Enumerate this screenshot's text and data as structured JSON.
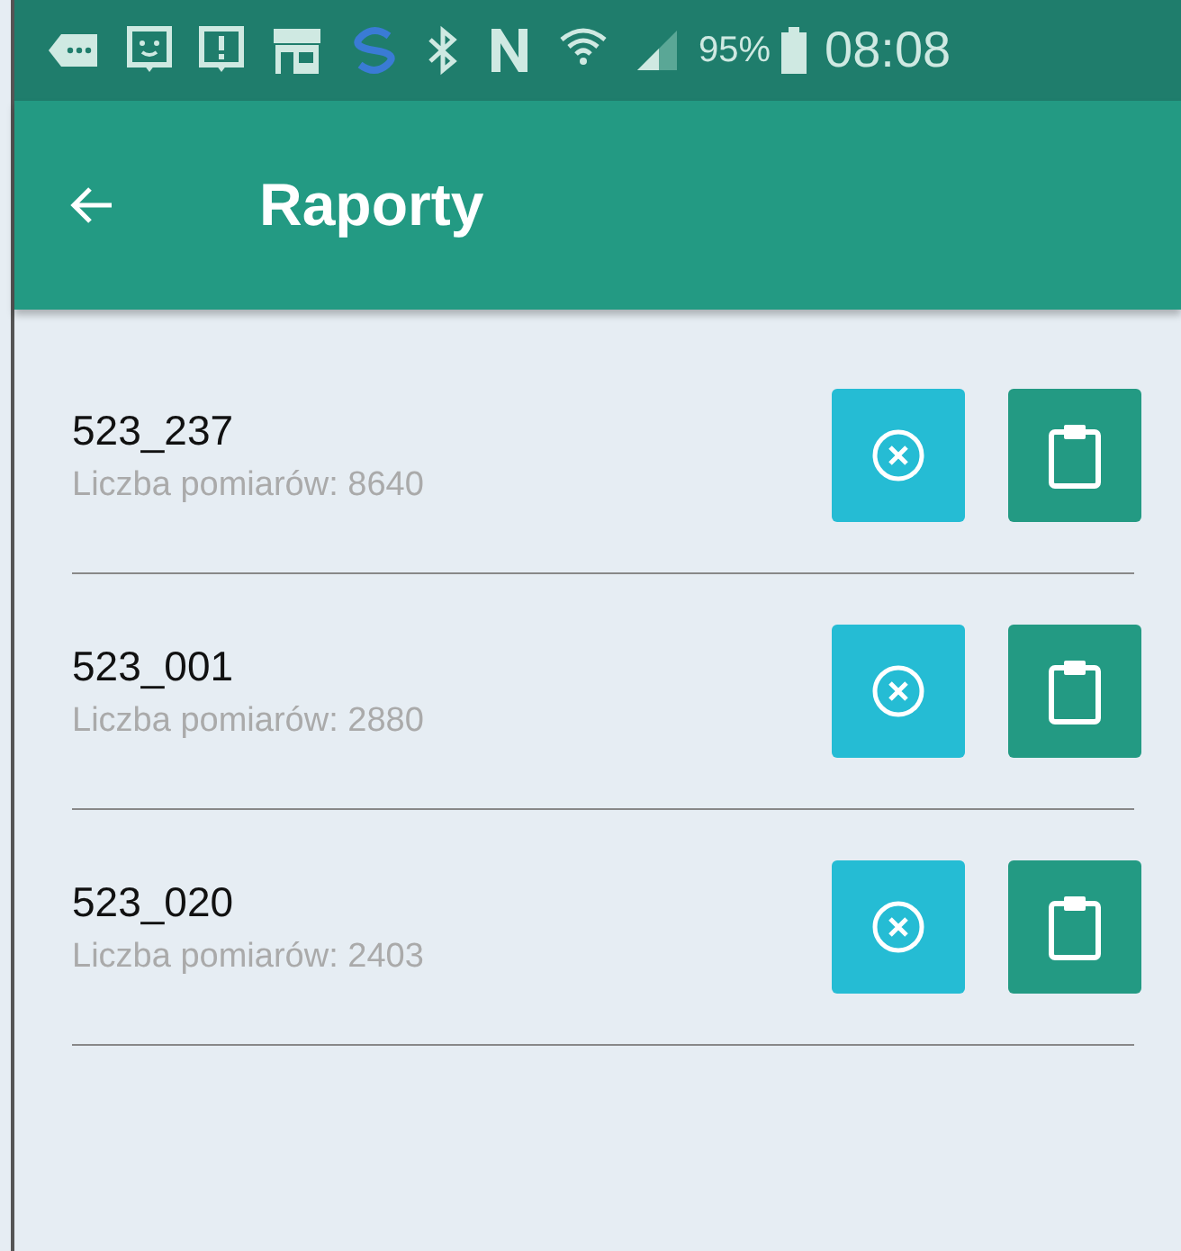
{
  "status_bar": {
    "battery": "95%",
    "time": "08:08"
  },
  "app_bar": {
    "title": "Raporty"
  },
  "reports": [
    {
      "name": "523_237",
      "subtitle": "Liczba pomiarów: 8640"
    },
    {
      "name": "523_001",
      "subtitle": "Liczba pomiarów: 2880"
    },
    {
      "name": "523_020",
      "subtitle": "Liczba pomiarów: 2403"
    }
  ]
}
